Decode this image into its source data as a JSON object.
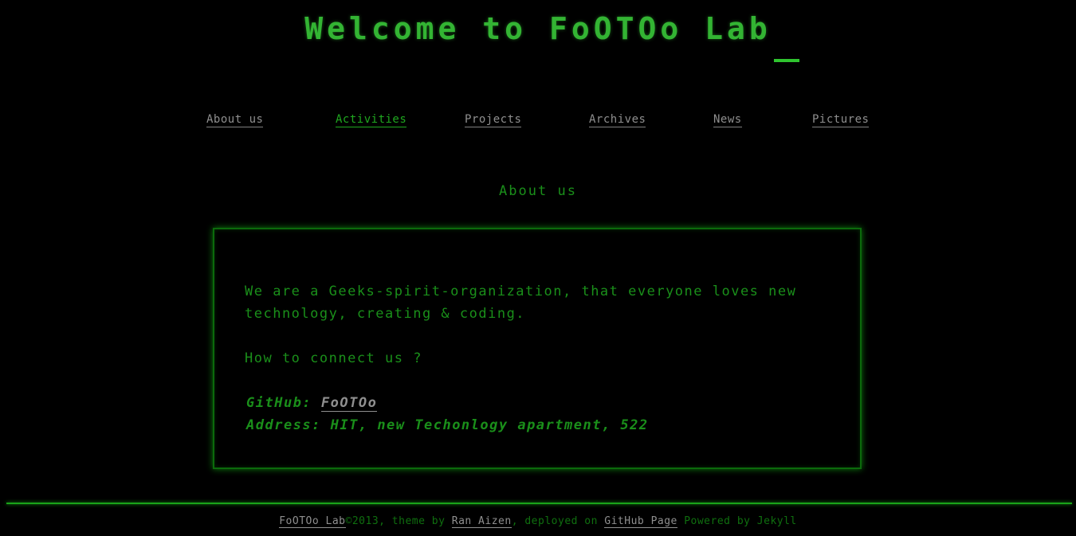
{
  "header": {
    "title": "Welcome to FoOTOo Lab"
  },
  "nav": {
    "items": [
      {
        "label": "About us",
        "active": false
      },
      {
        "label": "Activities",
        "active": true
      },
      {
        "label": "Projects",
        "active": false
      },
      {
        "label": "Archives",
        "active": false
      },
      {
        "label": "News",
        "active": false
      },
      {
        "label": "Pictures",
        "active": false
      }
    ]
  },
  "main": {
    "heading": "About us",
    "intro": "We are a Geeks-spirit-organization, that everyone loves new technology, creating & coding.",
    "connect_question": "How to connect us ?",
    "github_label": "GitHub:",
    "github_link": "FoOTOo",
    "address_label": "Address:",
    "address_value": "HIT, new Techonlogy apartment, 522"
  },
  "footer": {
    "site_link": "FoOTOo Lab",
    "copyright": "©2013, theme by ",
    "theme_author": "Ran Aizen",
    "deployed_text": ", deployed on ",
    "host_link": "GitHub Page",
    "powered_text": " Powered by Jekyll"
  },
  "colors": {
    "background": "#000000",
    "accent_green": "#33b433",
    "text_green": "#1a8f1a",
    "link_gray": "#8f8f8f"
  }
}
